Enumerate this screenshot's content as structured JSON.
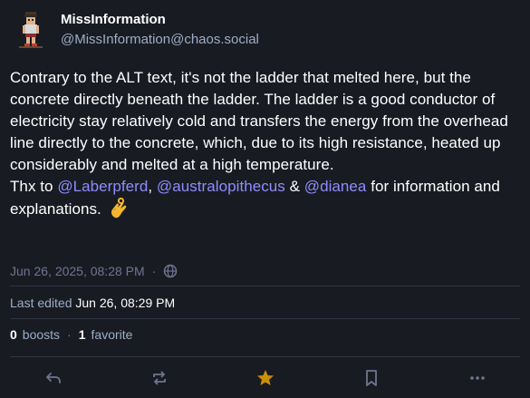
{
  "author": {
    "display_name": "MissInformation",
    "handle": "@MissInformation@chaos.social"
  },
  "content": {
    "line_1": "Contrary to the ALT text, it's not the ladder that melted here, but the concrete directly beneath the ladder. The ladder is a good conductor of electricity stay relatively cold and transfers the energy from the overhead line directly to the concrete, which, due to its high resistance, heated up considerably and melted at a high temperature.",
    "thanks_prefix": "Thx to ",
    "mention_1": "@Laberpferd",
    "sep_1": ", ",
    "mention_2": "@australopithecus",
    "sep_2": " & ",
    "mention_3": "@dianea",
    "thanks_suffix": " for information and explanations. ",
    "emoji": "ok-hand-emoji"
  },
  "meta": {
    "timestamp": "Jun 26, 2025, 08:28 PM",
    "separator": "·",
    "visibility_icon": "globe-icon"
  },
  "edited": {
    "label": "Last edited",
    "time": "Jun 26, 08:29 PM"
  },
  "counts": {
    "boosts_count": "0",
    "boosts_label": "boosts",
    "separator": "·",
    "favorites_count": "1",
    "favorites_label": "favorite"
  },
  "actions": [
    {
      "icon": "reply-icon"
    },
    {
      "icon": "boost-icon"
    },
    {
      "icon": "star-icon",
      "active_color": "#ca8f04"
    },
    {
      "icon": "bookmark-icon"
    },
    {
      "icon": "more-icon"
    }
  ],
  "colors": {
    "background": "#191b22",
    "mention": "#8c8dff",
    "muted": "#9baec8",
    "favorite": "#ca8f04"
  }
}
